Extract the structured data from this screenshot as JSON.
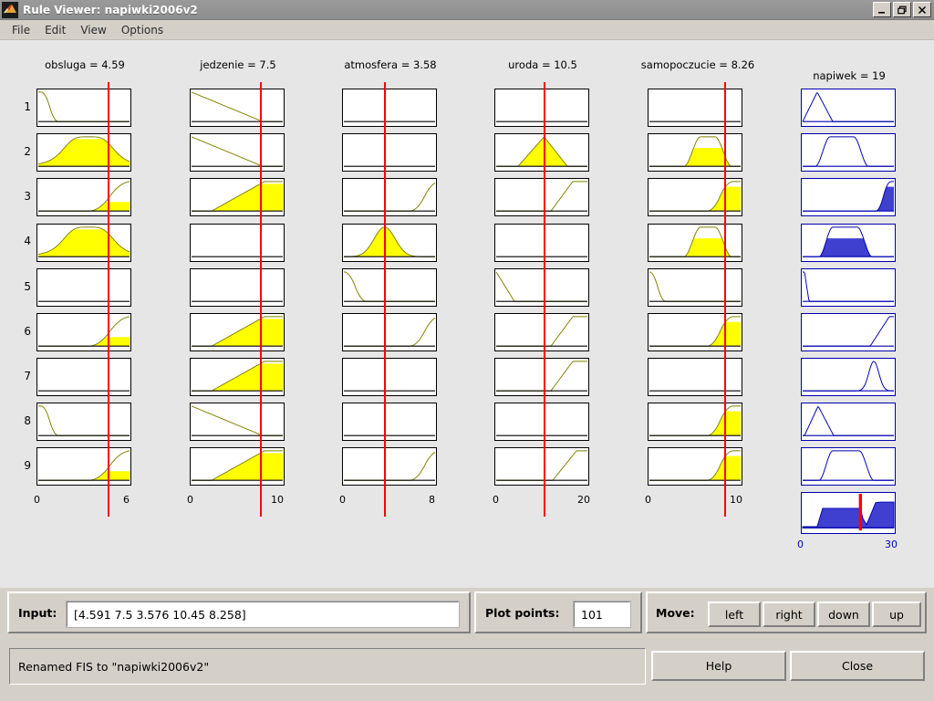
{
  "window": {
    "title": "Rule Viewer: napiwki2006v2",
    "icon": "matlab-logo-icon",
    "minimize_label": "_",
    "maximize_label": "❐",
    "close_label": "×"
  },
  "menu": {
    "items": [
      {
        "label": "File"
      },
      {
        "label": "Edit"
      },
      {
        "label": "View"
      },
      {
        "label": "Options"
      }
    ]
  },
  "rule_viewer": {
    "rule_numbers": [
      "1",
      "2",
      "3",
      "4",
      "5",
      "6",
      "7",
      "8",
      "9"
    ],
    "inputs": [
      {
        "name": "obsluga",
        "value": "4.59",
        "header": "obsluga = 4.59",
        "min": "0",
        "max": "6",
        "marker_frac": 0.765
      },
      {
        "name": "jedzenie",
        "value": "7.5",
        "header": "jedzenie = 7.5",
        "min": "0",
        "max": "10",
        "marker_frac": 0.75
      },
      {
        "name": "atmosfera",
        "value": "3.58",
        "header": "atmosfera = 3.58",
        "min": "0",
        "max": "8",
        "marker_frac": 0.447
      },
      {
        "name": "uroda",
        "value": "10.5",
        "header": "uroda = 10.5",
        "min": "0",
        "max": "20",
        "marker_frac": 0.525
      },
      {
        "name": "samopoczucie",
        "value": "8.26",
        "header": "samopoczucie = 8.26",
        "min": "0",
        "max": "10",
        "marker_frac": 0.826
      }
    ],
    "output": {
      "name": "napiwek",
      "value": "19",
      "header": "napiwek = 19",
      "min": "0",
      "max": "30",
      "defuzz_frac": 0.633
    },
    "colors": {
      "input_fill": "#ffff00",
      "output_fill": "#4040d0",
      "curve": "#808000",
      "output_curve": "#0000b0",
      "marker": "#ff0000",
      "plot_bg": "#ffffff",
      "panel_bg": "#d4d0c8",
      "canvas_bg": "#e6e6e6"
    }
  },
  "chart_data": {
    "type": "line",
    "title": "Fuzzy Rule Viewer membership activation grid",
    "xlabel": "",
    "ylabel": "",
    "grid": false,
    "legend": "none",
    "antecedent_columns": [
      "obsluga",
      "jedzenie",
      "atmosfera",
      "uroda",
      "samopoczucie"
    ],
    "consequent_column": "napiwek",
    "xlim_per_column": [
      [
        0,
        6
      ],
      [
        0,
        10
      ],
      [
        0,
        8
      ],
      [
        0,
        20
      ],
      [
        0,
        10
      ],
      [
        0,
        30
      ]
    ],
    "ylim": [
      0,
      1
    ],
    "crisp_inputs": [
      4.591,
      7.5,
      3.576,
      10.45,
      8.258
    ],
    "defuzzified_output": 19,
    "cells": [
      {
        "col": 0,
        "row": 0,
        "shape": "zmf",
        "p": [
          0.03,
          0.22
        ],
        "alpha": 0.0
      },
      {
        "col": 0,
        "row": 1,
        "shape": "gbell",
        "p": [
          0.55,
          0.3
        ],
        "alpha": 0.92
      },
      {
        "col": 0,
        "row": 2,
        "shape": "smf",
        "p": [
          0.55,
          1.02
        ],
        "alpha": 0.31
      },
      {
        "col": 0,
        "row": 3,
        "shape": "gbell",
        "p": [
          0.55,
          0.3
        ],
        "alpha": 0.92
      },
      {
        "col": 0,
        "row": 4,
        "shape": "none",
        "p": [],
        "alpha": 0.0
      },
      {
        "col": 0,
        "row": 5,
        "shape": "smf",
        "p": [
          0.55,
          1.02
        ],
        "alpha": 0.31
      },
      {
        "col": 0,
        "row": 6,
        "shape": "none",
        "p": [],
        "alpha": 0.0
      },
      {
        "col": 0,
        "row": 7,
        "shape": "zmf",
        "p": [
          0.03,
          0.22
        ],
        "alpha": 0.0
      },
      {
        "col": 0,
        "row": 8,
        "shape": "smf",
        "p": [
          0.55,
          1.02
        ],
        "alpha": 0.31
      },
      {
        "col": 1,
        "row": 0,
        "shape": "lin_down",
        "p": [
          0.0,
          0.78
        ],
        "alpha": 0.0
      },
      {
        "col": 1,
        "row": 1,
        "shape": "lin_down",
        "p": [
          0.0,
          0.78
        ],
        "alpha": 0.0
      },
      {
        "col": 1,
        "row": 2,
        "shape": "lin_up",
        "p": [
          0.22,
          0.8
        ],
        "alpha": 0.92
      },
      {
        "col": 1,
        "row": 3,
        "shape": "none",
        "p": [],
        "alpha": 0.0
      },
      {
        "col": 1,
        "row": 4,
        "shape": "none",
        "p": [],
        "alpha": 0.0
      },
      {
        "col": 1,
        "row": 5,
        "shape": "lin_up",
        "p": [
          0.22,
          0.8
        ],
        "alpha": 0.92
      },
      {
        "col": 1,
        "row": 6,
        "shape": "lin_up",
        "p": [
          0.22,
          0.8
        ],
        "alpha": 0.92
      },
      {
        "col": 1,
        "row": 7,
        "shape": "lin_down",
        "p": [
          0.0,
          0.78
        ],
        "alpha": 0.0
      },
      {
        "col": 1,
        "row": 8,
        "shape": "lin_up",
        "p": [
          0.22,
          0.8
        ],
        "alpha": 0.92
      },
      {
        "col": 2,
        "row": 0,
        "shape": "none",
        "p": [],
        "alpha": 0.0
      },
      {
        "col": 2,
        "row": 1,
        "shape": "none",
        "p": [],
        "alpha": 0.0
      },
      {
        "col": 2,
        "row": 2,
        "shape": "smf",
        "p": [
          0.72,
          1.05
        ],
        "alpha": 0.0
      },
      {
        "col": 2,
        "row": 3,
        "shape": "gauss",
        "p": [
          0.447,
          0.115
        ],
        "alpha": 1.0
      },
      {
        "col": 2,
        "row": 4,
        "shape": "zmf",
        "p": [
          0.0,
          0.25
        ],
        "alpha": 0.0
      },
      {
        "col": 2,
        "row": 5,
        "shape": "smf",
        "p": [
          0.72,
          1.05
        ],
        "alpha": 0.0
      },
      {
        "col": 2,
        "row": 6,
        "shape": "none",
        "p": [],
        "alpha": 0.0
      },
      {
        "col": 2,
        "row": 7,
        "shape": "none",
        "p": [],
        "alpha": 0.0
      },
      {
        "col": 2,
        "row": 8,
        "shape": "smf",
        "p": [
          0.72,
          1.05
        ],
        "alpha": 0.0
      },
      {
        "col": 3,
        "row": 0,
        "shape": "none",
        "p": [],
        "alpha": 0.0
      },
      {
        "col": 3,
        "row": 1,
        "shape": "tri",
        "p": [
          0.24,
          0.525,
          0.78
        ],
        "alpha": 1.0
      },
      {
        "col": 3,
        "row": 2,
        "shape": "ramp_up",
        "p": [
          0.6,
          0.84
        ],
        "alpha": 0.0
      },
      {
        "col": 3,
        "row": 3,
        "shape": "none",
        "p": [],
        "alpha": 0.0
      },
      {
        "col": 3,
        "row": 4,
        "shape": "ramp_down",
        "p": [
          0.0,
          0.2
        ],
        "alpha": 0.0
      },
      {
        "col": 3,
        "row": 5,
        "shape": "ramp_up",
        "p": [
          0.6,
          0.84
        ],
        "alpha": 0.0
      },
      {
        "col": 3,
        "row": 6,
        "shape": "ramp_up",
        "p": [
          0.6,
          0.84
        ],
        "alpha": 0.0
      },
      {
        "col": 3,
        "row": 7,
        "shape": "none",
        "p": [],
        "alpha": 0.0
      },
      {
        "col": 3,
        "row": 8,
        "shape": "ramp_up",
        "p": [
          0.62,
          0.88
        ],
        "alpha": 0.0
      },
      {
        "col": 4,
        "row": 0,
        "shape": "none",
        "p": [],
        "alpha": 0.0
      },
      {
        "col": 4,
        "row": 1,
        "shape": "trap_bell",
        "p": [
          0.38,
          0.56,
          0.72,
          0.9
        ],
        "alpha": 0.62
      },
      {
        "col": 4,
        "row": 2,
        "shape": "smf",
        "p": [
          0.63,
          0.92
        ],
        "alpha": 0.82
      },
      {
        "col": 4,
        "row": 3,
        "shape": "trap_bell",
        "p": [
          0.38,
          0.56,
          0.72,
          0.9
        ],
        "alpha": 0.62
      },
      {
        "col": 4,
        "row": 4,
        "shape": "zmf",
        "p": [
          0.0,
          0.18
        ],
        "alpha": 0.0
      },
      {
        "col": 4,
        "row": 5,
        "shape": "smf",
        "p": [
          0.63,
          0.92
        ],
        "alpha": 0.82
      },
      {
        "col": 4,
        "row": 6,
        "shape": "none",
        "p": [],
        "alpha": 0.0
      },
      {
        "col": 4,
        "row": 7,
        "shape": "smf",
        "p": [
          0.63,
          0.92
        ],
        "alpha": 0.82
      },
      {
        "col": 4,
        "row": 8,
        "shape": "smf",
        "p": [
          0.63,
          0.92
        ],
        "alpha": 0.82
      },
      {
        "col": 5,
        "row": 0,
        "shape": "tri",
        "p": [
          0.0,
          0.16,
          0.33
        ],
        "alpha": 0.0
      },
      {
        "col": 5,
        "row": 1,
        "shape": "trap_bell",
        "p": [
          0.14,
          0.3,
          0.56,
          0.72
        ],
        "alpha": 0.0
      },
      {
        "col": 5,
        "row": 2,
        "shape": "smf",
        "p": [
          0.8,
          0.97
        ],
        "alpha": 0.82
      },
      {
        "col": 5,
        "row": 3,
        "shape": "trap_bell",
        "p": [
          0.18,
          0.33,
          0.6,
          0.76
        ],
        "alpha": 0.62
      },
      {
        "col": 5,
        "row": 4,
        "shape": "spike_left",
        "p": [
          0.02,
          0.07
        ],
        "alpha": 0.0
      },
      {
        "col": 5,
        "row": 5,
        "shape": "ramp_up",
        "p": [
          0.74,
          0.95
        ],
        "alpha": 0.0
      },
      {
        "col": 5,
        "row": 6,
        "shape": "narrow_bell",
        "p": [
          0.78,
          0.055
        ],
        "alpha": 0.0
      },
      {
        "col": 5,
        "row": 7,
        "shape": "tri",
        "p": [
          0.02,
          0.17,
          0.34
        ],
        "alpha": 0.0
      },
      {
        "col": 5,
        "row": 8,
        "shape": "trap_bell",
        "p": [
          0.18,
          0.33,
          0.62,
          0.78
        ],
        "alpha": 0.0
      }
    ],
    "aggregate": {
      "description": "Aggregated output membership with centroid defuzzification marker",
      "polyline": [
        [
          0.0,
          0.04
        ],
        [
          0.16,
          0.04
        ],
        [
          0.22,
          0.62
        ],
        [
          0.36,
          0.62
        ],
        [
          0.56,
          0.62
        ],
        [
          0.6,
          0.62
        ],
        [
          0.633,
          0.62
        ],
        [
          0.66,
          0.3
        ],
        [
          0.7,
          0.1
        ],
        [
          0.735,
          0.34
        ],
        [
          0.8,
          0.8
        ],
        [
          0.86,
          0.82
        ],
        [
          1.0,
          0.82
        ],
        [
          1.0,
          0.0
        ],
        [
          0.0,
          0.0
        ]
      ]
    }
  },
  "controls": {
    "input_label": "Input:",
    "input_value": "[4.591 7.5 3.576 10.45 8.258]",
    "plot_points_label": "Plot points:",
    "plot_points_value": "101",
    "move_label": "Move:",
    "move_buttons": [
      {
        "label": "left",
        "name": "move-left-button"
      },
      {
        "label": "right",
        "name": "move-right-button"
      },
      {
        "label": "down",
        "name": "move-down-button"
      },
      {
        "label": "up",
        "name": "move-up-button"
      }
    ]
  },
  "status": {
    "message": "Renamed FIS to \"napiwki2006v2\"",
    "help_label": "Help",
    "close_label": "Close"
  }
}
